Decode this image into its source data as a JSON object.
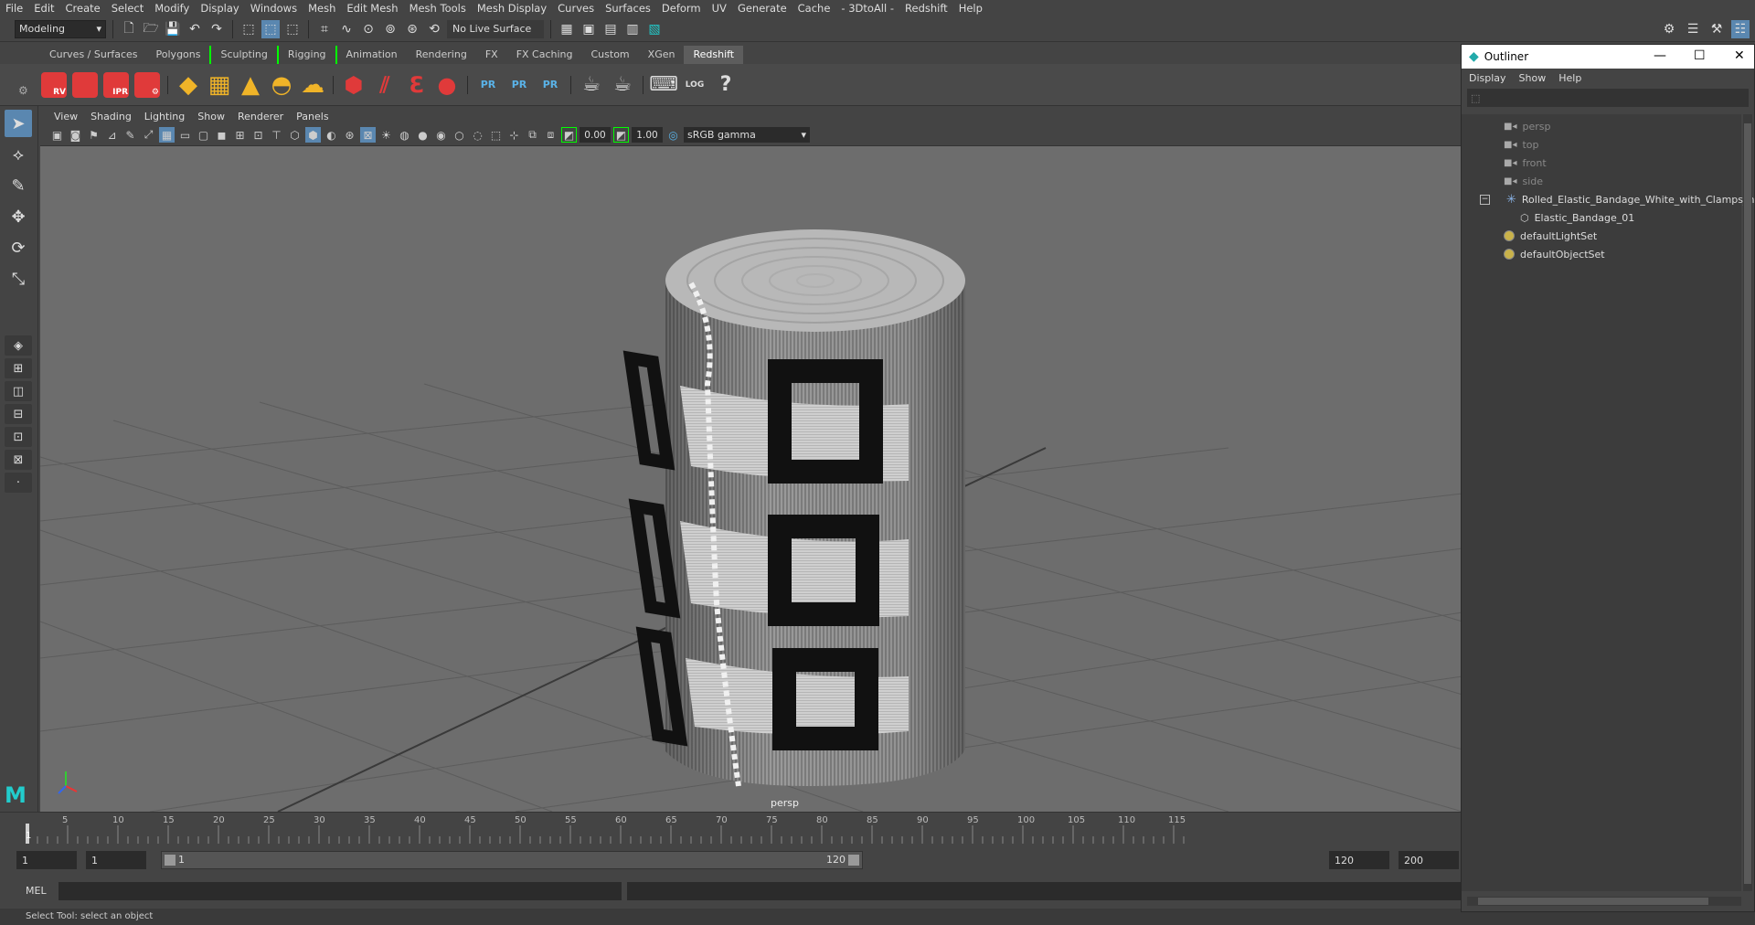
{
  "menubar": [
    "File",
    "Edit",
    "Create",
    "Select",
    "Modify",
    "Display",
    "Windows",
    "Mesh",
    "Edit Mesh",
    "Mesh Tools",
    "Mesh Display",
    "Curves",
    "Surfaces",
    "Deform",
    "UV",
    "Generate",
    "Cache",
    "- 3DtoAll -",
    "Redshift",
    "Help"
  ],
  "status": {
    "mode": "Modeling",
    "live_surface": "No Live Surface"
  },
  "shelf_tabs": [
    {
      "label": "Curves / Surfaces",
      "active": false
    },
    {
      "label": "Polygons",
      "active": false
    },
    {
      "label": "Sculpting",
      "active": false
    },
    {
      "label": "Rigging",
      "active": false
    },
    {
      "label": "Animation",
      "active": false
    },
    {
      "label": "Rendering",
      "active": false
    },
    {
      "label": "FX",
      "active": false
    },
    {
      "label": "FX Caching",
      "active": false
    },
    {
      "label": "Custom",
      "active": false
    },
    {
      "label": "XGen",
      "active": false
    },
    {
      "label": "Redshift",
      "active": true
    }
  ],
  "shelf_labels": {
    "rv": "RV",
    "ipr": "IPR",
    "pr1": "PR",
    "pr2": "PR",
    "pr3": "PR",
    "log": "LOG",
    "help": "?"
  },
  "viewport": {
    "menu": [
      "View",
      "Shading",
      "Lighting",
      "Show",
      "Renderer",
      "Panels"
    ],
    "exposure": "0.00",
    "gamma_value": "1.00",
    "color_space": "sRGB gamma",
    "camera": "persp"
  },
  "timeline": {
    "ticks": [
      "5",
      "10",
      "15",
      "20",
      "25",
      "30",
      "35",
      "40",
      "45",
      "50",
      "55",
      "60",
      "65",
      "70",
      "75",
      "80",
      "85",
      "90",
      "95",
      "100",
      "105",
      "110",
      "115"
    ],
    "current_frame_marker": "1",
    "range_start": "1",
    "playback_start": "1",
    "slider_start": "1",
    "slider_end": "120",
    "playback_end": "120",
    "range_end": "200"
  },
  "cmdline": {
    "label": "MEL"
  },
  "statusbar": {
    "text": "Select Tool: select an object"
  },
  "outliner": {
    "title": "Outliner",
    "menu": [
      "Display",
      "Show",
      "Help"
    ],
    "items": [
      {
        "label": "persp",
        "kind": "camera"
      },
      {
        "label": "top",
        "kind": "camera"
      },
      {
        "label": "front",
        "kind": "camera"
      },
      {
        "label": "side",
        "kind": "camera"
      },
      {
        "label": "Rolled_Elastic_Bandage_White_with_Clamps_ncl",
        "kind": "transform"
      },
      {
        "label": "Elastic_Bandage_01",
        "kind": "mesh"
      },
      {
        "label": "defaultLightSet",
        "kind": "set"
      },
      {
        "label": "defaultObjectSet",
        "kind": "set"
      }
    ]
  },
  "colors": {
    "viewport_bg": "#6d6d6d",
    "active_tool": "#5a87b0",
    "redshift_red": "#e03a3a",
    "accent_cyan": "#22cccc"
  }
}
